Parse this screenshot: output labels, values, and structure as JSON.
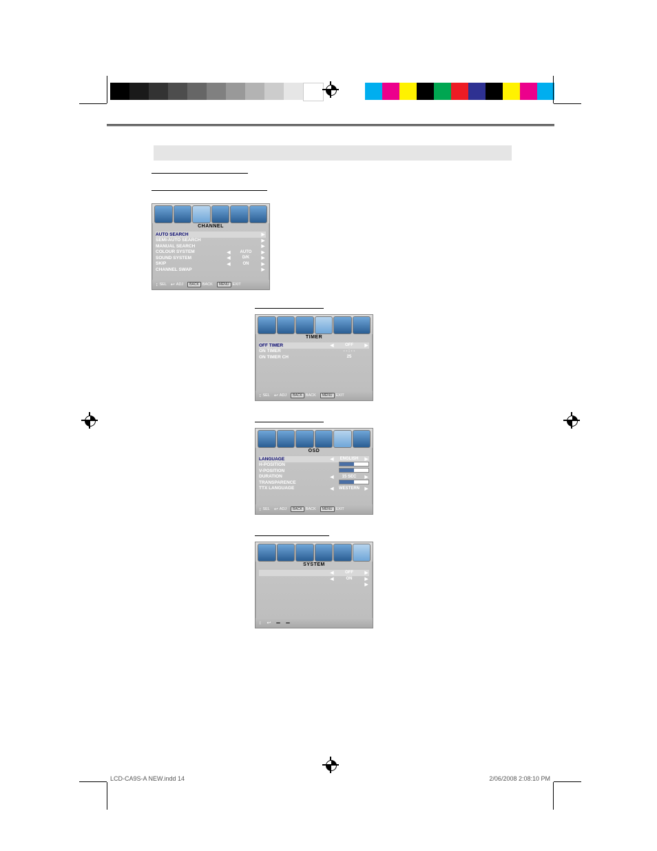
{
  "footer": {
    "left": "LCD-CA9S-A NEW.indd   14",
    "right": "2/06/2008   2:08:10 PM"
  },
  "color_bars": {
    "left": [
      "#000000",
      "#1a1a1a",
      "#333333",
      "#4d4d4d",
      "#666666",
      "#808080",
      "#999999",
      "#b3b3b3",
      "#cccccc",
      "#e6e6e6",
      "#ffffff"
    ],
    "right": [
      "#00aeef",
      "#ec008c",
      "#fff200",
      "#000000",
      "#00a651",
      "#ed1c24",
      "#2e3192",
      "#000000",
      "#fff200",
      "#ec008c",
      "#00aeef"
    ]
  },
  "menus": {
    "channel": {
      "title": "CHANNEL",
      "rows": [
        {
          "label": "AUTO SEARCH",
          "type": "arrowR",
          "hl": true
        },
        {
          "label": "SEMI-AUTO SEARCH",
          "type": "arrowR"
        },
        {
          "label": "MANUAL SEARCH",
          "type": "arrowR"
        },
        {
          "label": "COLOUR SYSTEM",
          "type": "val",
          "val": "AUTO"
        },
        {
          "label": "SOUND SYSTEM",
          "type": "val",
          "val": "D/K"
        },
        {
          "label": "SKIP",
          "type": "val",
          "val": "ON"
        },
        {
          "label": "CHANNEL SWAP",
          "type": "arrowR"
        }
      ],
      "foot": [
        {
          "sym": "↕",
          "t": "SEL"
        },
        {
          "sym": "↩",
          "t": "ADJ"
        },
        {
          "key": "BACK",
          "t": "BACK"
        },
        {
          "key": "MENU",
          "t": "EXIT"
        }
      ]
    },
    "timer": {
      "title": "TIMER",
      "rows": [
        {
          "label": "OFF TIMER",
          "type": "val",
          "val": "OFF",
          "hl": true
        },
        {
          "label": "ON TIMER",
          "type": "text",
          "val": "- - : - -"
        },
        {
          "label": "ON TIMER CH",
          "type": "text",
          "val": "25"
        }
      ],
      "foot": [
        {
          "sym": "↕",
          "t": "SEL"
        },
        {
          "sym": "↩",
          "t": "ADJ"
        },
        {
          "key": "BACK",
          "t": "BACK"
        },
        {
          "key": "MENU",
          "t": "EXIT"
        }
      ]
    },
    "osd": {
      "title": "OSD",
      "rows": [
        {
          "label": "LANGUAGE",
          "type": "val",
          "val": "ENGLISH",
          "hl": true
        },
        {
          "label": "H-POSITION",
          "type": "bar",
          "pct": 50,
          "num": "50"
        },
        {
          "label": "V-POSITION",
          "type": "bar",
          "pct": 50,
          "num": "50"
        },
        {
          "label": "DURATION",
          "type": "val",
          "val": "15 SEC"
        },
        {
          "label": "TRANSPARENCE",
          "type": "bar",
          "pct": 50,
          "num": "50"
        },
        {
          "label": "TTX LANGUAGE",
          "type": "val",
          "val": "WESTERN"
        }
      ],
      "foot": [
        {
          "sym": "↕",
          "t": "SEL"
        },
        {
          "sym": "↩",
          "t": "ADJ"
        },
        {
          "key": "BACK",
          "t": "BACK"
        },
        {
          "key": "MENU",
          "t": "EXIT"
        }
      ]
    },
    "system": {
      "title": "SYSTEM",
      "rows": [
        {
          "label": "",
          "type": "val",
          "val": "OFF",
          "hl": true
        },
        {
          "label": "",
          "type": "val",
          "val": "ON"
        },
        {
          "label": "",
          "type": "arrowR"
        }
      ],
      "foot": [
        {
          "sym": "↕",
          "t": ""
        },
        {
          "sym": "↩",
          "t": ""
        },
        {
          "key": " ",
          "t": ""
        },
        {
          "key": " ",
          "t": ""
        }
      ]
    }
  }
}
